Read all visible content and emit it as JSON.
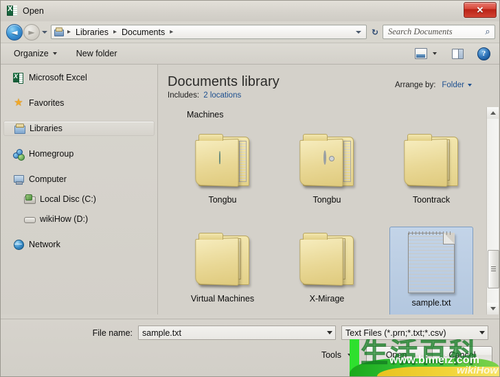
{
  "window": {
    "title": "Open",
    "app_icon": "excel-icon",
    "close_label": "✕"
  },
  "address_bar": {
    "back_icon": "back-arrow-icon",
    "back_glyph": "◄",
    "forward_icon": "forward-arrow-icon",
    "forward_glyph": "►",
    "history_icon": "chevron-down-icon",
    "location_icon": "libraries-icon",
    "breadcrumbs": [
      "Libraries",
      "Documents"
    ],
    "separator": "▸",
    "refresh_icon": "refresh-icon",
    "refresh_glyph": "↻",
    "search_placeholder": "Search Documents",
    "search_value": "",
    "search_icon": "magnifier-icon",
    "search_glyph": "⌕"
  },
  "toolbar": {
    "organize_label": "Organize",
    "new_folder_label": "New folder",
    "view_icon": "view-options-icon",
    "preview_pane_icon": "preview-pane-icon",
    "help_icon": "help-icon",
    "help_glyph": "?"
  },
  "sidebar": {
    "items": [
      {
        "label": "Microsoft Excel",
        "icon": "excel-icon",
        "indent": 0,
        "selected": false,
        "gap_after": 15
      },
      {
        "label": "Favorites",
        "icon": "star-icon",
        "indent": 0,
        "selected": false,
        "gap_after": 15
      },
      {
        "label": "Libraries",
        "icon": "libraries-icon",
        "indent": 0,
        "selected": true,
        "gap_after": 15
      },
      {
        "label": "Homegroup",
        "icon": "homegroup-icon",
        "indent": 0,
        "selected": false,
        "gap_after": 15
      },
      {
        "label": "Computer",
        "icon": "computer-icon",
        "indent": 0,
        "selected": false,
        "gap_after": 0
      },
      {
        "label": "Local Disc (C:)",
        "icon": "harddisk-icon",
        "indent": 1,
        "selected": false,
        "gap_after": 0
      },
      {
        "label": "wikiHow (D:)",
        "icon": "drive-icon",
        "indent": 1,
        "selected": false,
        "gap_after": 15
      },
      {
        "label": "Network",
        "icon": "network-icon",
        "indent": 0,
        "selected": false,
        "gap_after": 0
      }
    ]
  },
  "library_header": {
    "title": "Documents library",
    "includes_label": "Includes:",
    "includes_link": "2 locations",
    "arrange_label": "Arrange by:",
    "arrange_value": "Folder"
  },
  "file_list": {
    "group_header": "Machines",
    "items": [
      {
        "name": "Tongbu",
        "icon": "folder-open-doc-icon",
        "art": "folder-blob",
        "selected": false
      },
      {
        "name": "Tongbu",
        "icon": "folder-open-gear-icon",
        "art": "folder-gear",
        "selected": false
      },
      {
        "name": "Toontrack",
        "icon": "folder-files-icon",
        "art": "folder-docs",
        "selected": false
      },
      {
        "name": "Virtual Machines",
        "icon": "folder-files-icon",
        "art": "folder-docs",
        "selected": false
      },
      {
        "name": "X-Mirage",
        "icon": "folder-files-icon",
        "art": "folder-docs",
        "selected": false
      },
      {
        "name": "sample.txt",
        "icon": "text-file-icon",
        "art": "textfile",
        "selected": true
      }
    ],
    "scroll_up_icon": "scroll-up-arrow-icon",
    "scroll_down_icon": "scroll-down-arrow-icon"
  },
  "footer": {
    "file_name_label": "File name:",
    "file_name_value": "sample.txt",
    "file_type_value": "Text Files (*.prn;*.txt;*.csv)",
    "tools_label": "Tools",
    "open_label": "Open",
    "cancel_label": "Cancel"
  },
  "watermark": {
    "chinese_text": "生活百科",
    "url": "www.bimeiz.com",
    "brand": "wikiHow"
  },
  "colors": {
    "window_bg": "#d4d1ca",
    "selection_blue": "#b2c6de",
    "link_blue": "#1c4f8f",
    "close_red": "#ba2316",
    "folder_yellow": "#e9d896",
    "watermark_green": "#2ee02e"
  }
}
